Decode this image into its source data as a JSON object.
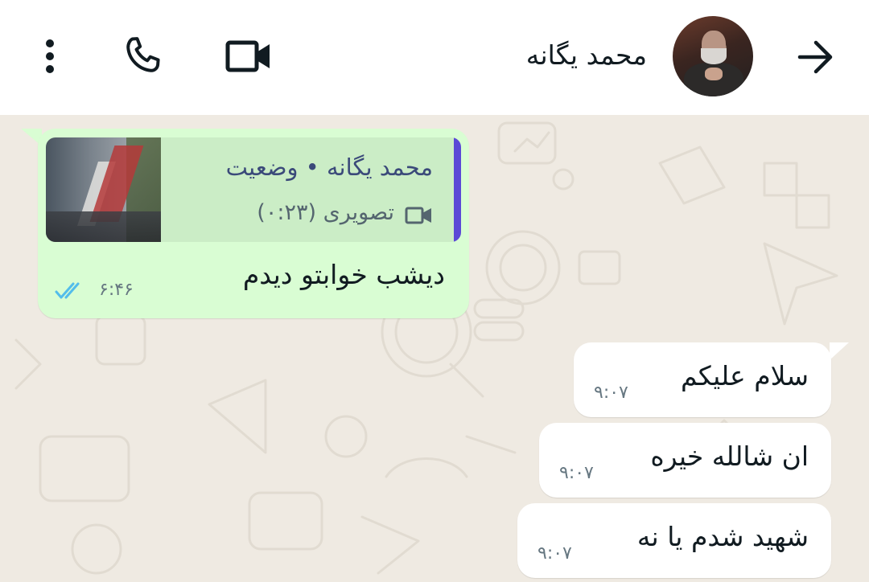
{
  "header": {
    "contact_name": "محمد یگانه",
    "icons": {
      "back": "arrow-back-icon",
      "video_call": "video-camera-icon",
      "voice_call": "phone-icon",
      "menu": "more-vertical-icon"
    }
  },
  "messages": [
    {
      "direction": "outgoing",
      "reply_to": {
        "title": "محمد یگانه • وضعیت",
        "media_label": "تصویری (۰:۲۳)",
        "media_icon": "video-icon"
      },
      "text": "دیشب خوابتو دیدم",
      "time": "۶:۴۶",
      "status": "read",
      "status_icon": "double-check-icon"
    },
    {
      "direction": "incoming",
      "text": "سلام علیکم",
      "time": "۹:۰۷"
    },
    {
      "direction": "incoming",
      "text": "ان شالله خیره",
      "time": "۹:۰۷"
    },
    {
      "direction": "incoming",
      "text": "شهید شدم یا نه",
      "time": "۹:۰۷"
    }
  ],
  "colors": {
    "header_bg": "#ffffff",
    "chat_bg": "#efeae2",
    "outgoing_bubble": "#d9fdd3",
    "incoming_bubble": "#ffffff",
    "quote_accent": "#5b49d6",
    "read_ticks": "#53bdeb"
  }
}
